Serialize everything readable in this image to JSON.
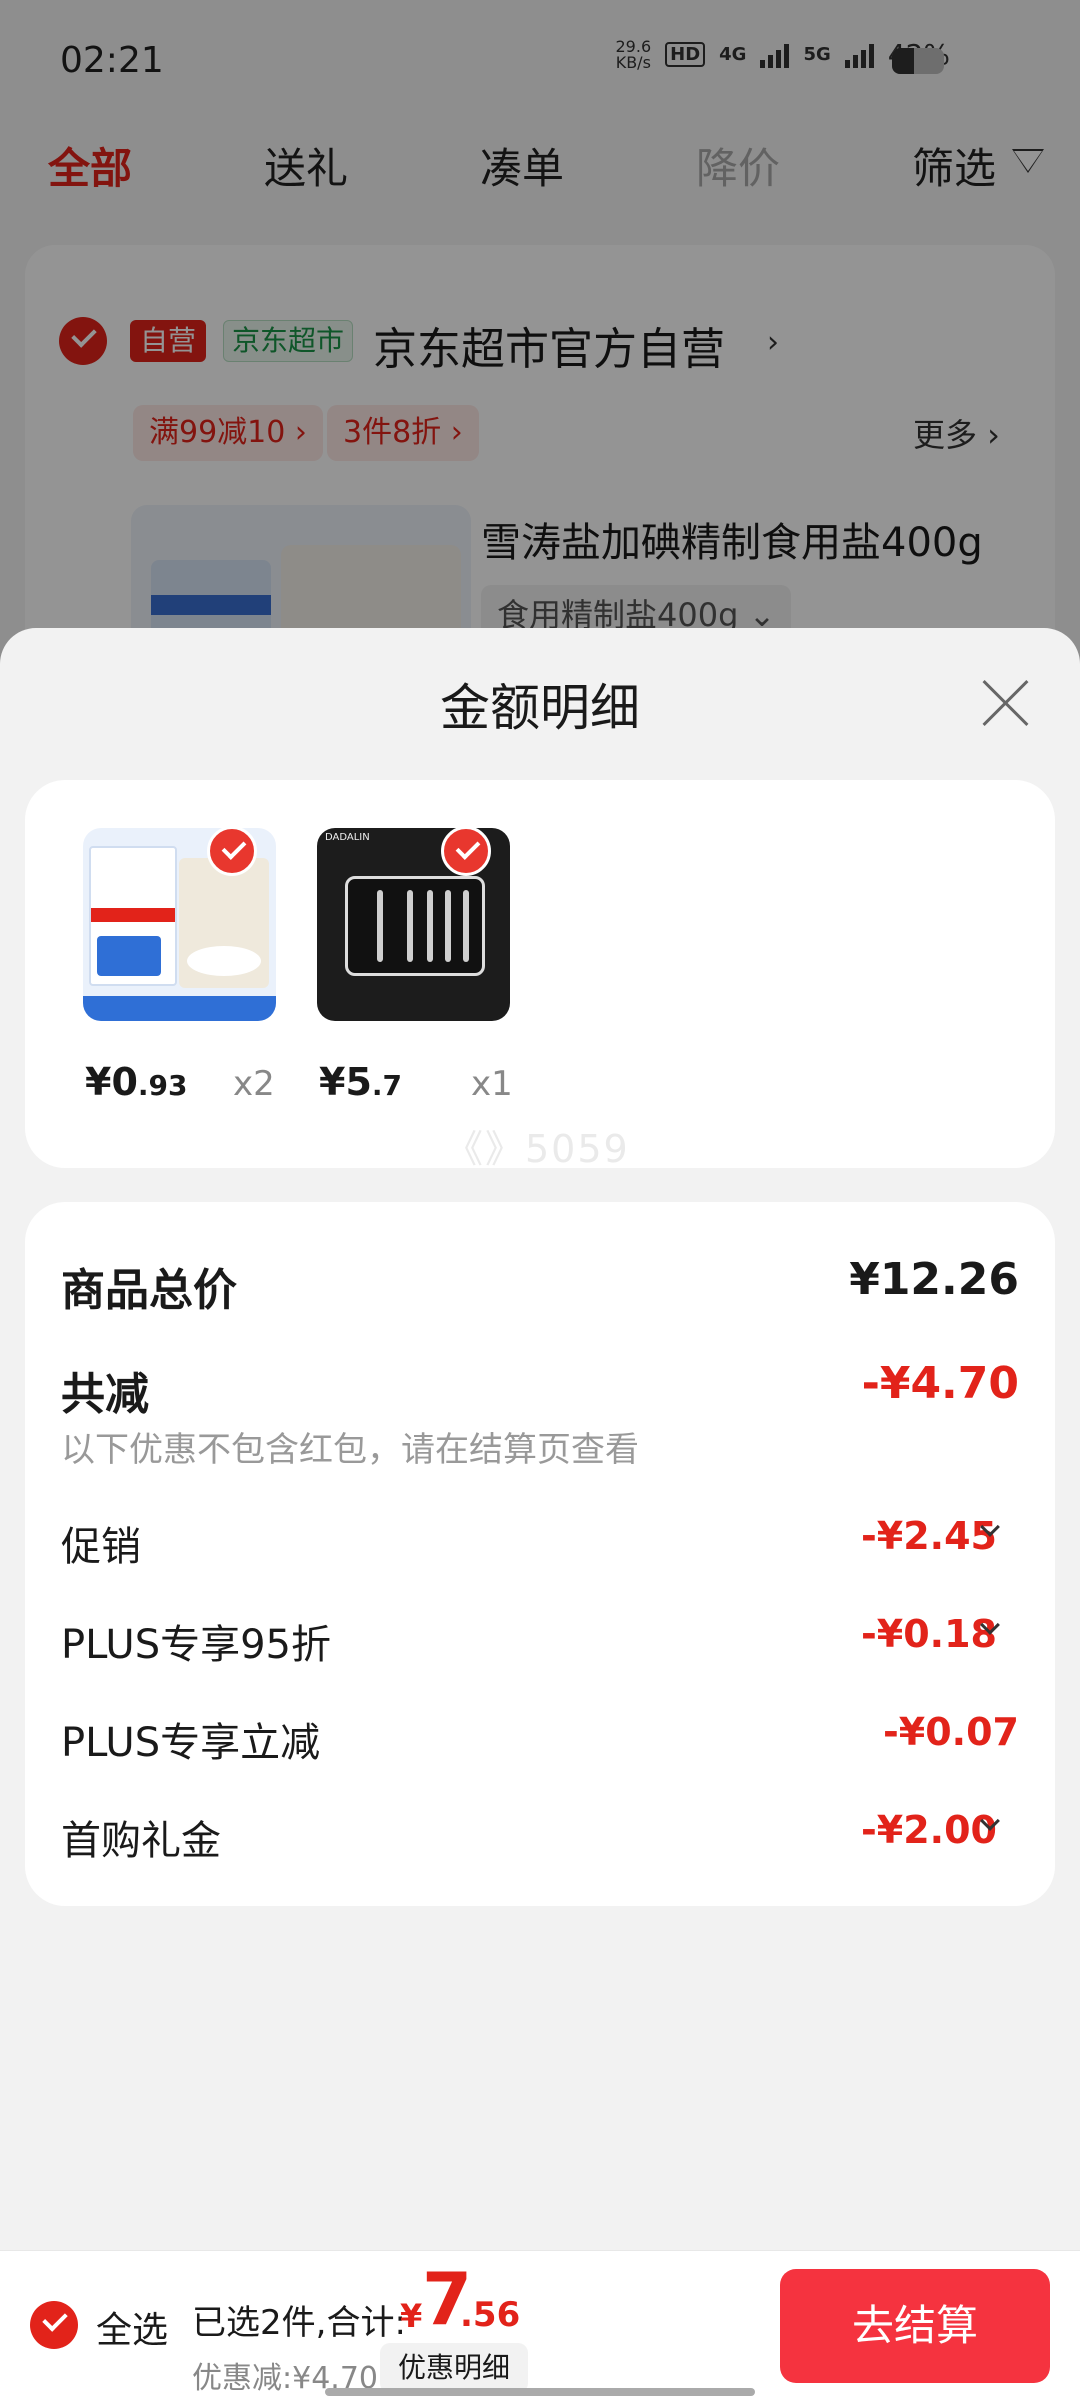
{
  "status_bar": {
    "time": "02:21",
    "net_speed_value": "29.6",
    "net_speed_unit": "KB/s",
    "hd": "HD",
    "sim": "1\n2",
    "net1": "4G",
    "net2": "5G",
    "battery": "42%",
    "battery_level": 0.42
  },
  "tabs": [
    {
      "label": "全部"
    },
    {
      "label": "送礼"
    },
    {
      "label": "凑单"
    },
    {
      "label": "降价"
    },
    {
      "label": "筛选"
    }
  ],
  "shop": {
    "tag_self": "自营",
    "tag_market": "京东超市",
    "name": "京东超市官方自营",
    "chevron": "›",
    "promos": [
      "满99减10 ›",
      "3件8折 ›"
    ],
    "more": "更多 ›",
    "product_title": "雪涛盐加碘精制食用盐400g",
    "product_spec": "食用精制盐400g ⌄"
  },
  "sheet": {
    "title": "金额明细",
    "items": [
      {
        "price_int": "¥0",
        "price_dec": ".93",
        "qty": "x2",
        "icon": "salt-product-image"
      },
      {
        "price_int": "¥5",
        "price_dec": ".7",
        "qty": "x1",
        "icon": "nail-clipper-set-image",
        "brand": "DADALIN"
      }
    ],
    "watermark": "《》5059",
    "summary": {
      "total_label": "商品总价",
      "total_value": "¥12.26",
      "reduce_label": "共减",
      "reduce_value": "-¥4.70",
      "note": "以下优惠不包含红包，请在结算页查看",
      "rows": [
        {
          "label": "促销",
          "value": "-¥2.45"
        },
        {
          "label": "PLUS专享95折",
          "value": "-¥0.18"
        },
        {
          "label": "PLUS专享立减",
          "value": "-¥0.07"
        },
        {
          "label": "首购礼金",
          "value": "-¥2.00"
        }
      ]
    }
  },
  "bottom_bar": {
    "select_all": "全选",
    "total_label": "已选2件,合计:",
    "yen": "¥",
    "total_int": "7",
    "total_dec": ".56",
    "discount": "优惠减:¥4.70",
    "detail_button": "优惠明细",
    "checkout": "去结算"
  },
  "colors": {
    "accent": "#e2231a",
    "checkout": "#f5333f",
    "market_green": "#1a9447"
  }
}
